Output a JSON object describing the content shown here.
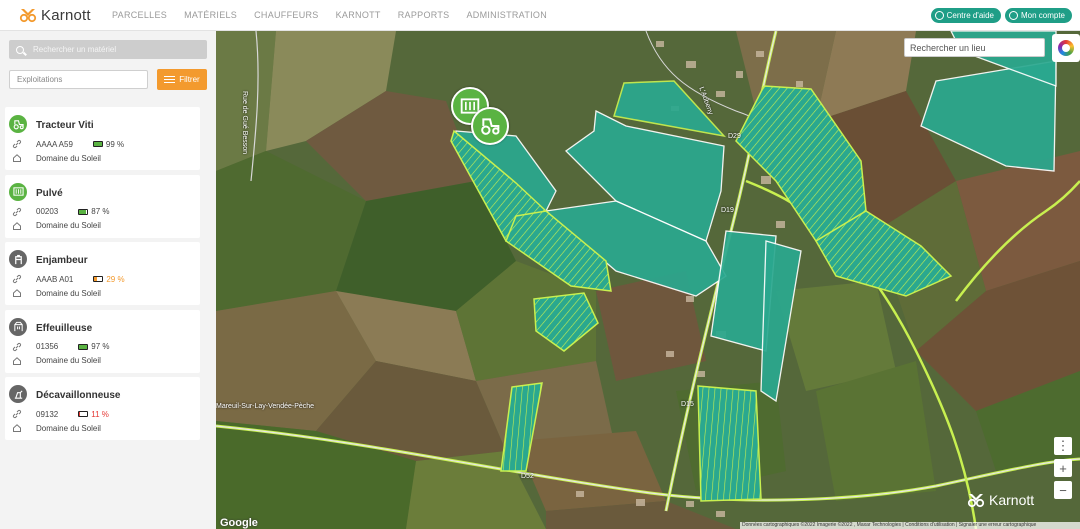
{
  "app": {
    "name": "Karnott"
  },
  "nav": [
    "PARCELLES",
    "MATÉRIELS",
    "CHAUFFEURS",
    "KARNOTT",
    "RAPPORTS",
    "ADMINISTRATION"
  ],
  "header_buttons": {
    "help": "Centre d'aide",
    "account": "Mon compte"
  },
  "sidebar": {
    "search_placeholder": "Rechercher un matériel",
    "collapse_icon": "double-chevron-left",
    "exploitations_placeholder": "Exploitations",
    "filter_label": "Filtrer",
    "equipment": [
      {
        "name": "Tracteur Viti",
        "icon": "tractor-icon",
        "badge_color": "#5ab342",
        "id": "AAAA A59",
        "battery": "99 %",
        "battery_level": 0.99,
        "battery_color": "#5ab342",
        "location": "Domaine du Soleil"
      },
      {
        "name": "Pulvé",
        "icon": "sprayer-icon",
        "badge_color": "#5ab342",
        "id": "00203",
        "battery": "87 %",
        "battery_level": 0.87,
        "battery_color": "#5ab342",
        "location": "Domaine du Soleil"
      },
      {
        "name": "Enjambeur",
        "icon": "straddle-tractor-icon",
        "badge_color": "#666666",
        "id": "AAAB A01",
        "battery": "29 %",
        "battery_level": 0.29,
        "battery_color": "#f39a2e",
        "location": "Domaine du Soleil"
      },
      {
        "name": "Effeuilleuse",
        "icon": "leaf-stripper-icon",
        "badge_color": "#666666",
        "id": "01356",
        "battery": "97 %",
        "battery_level": 0.97,
        "battery_color": "#5ab342",
        "location": "Domaine du Soleil"
      },
      {
        "name": "Décavaillonneuse",
        "icon": "plough-icon",
        "badge_color": "#666666",
        "id": "09132",
        "battery": "11 %",
        "battery_level": 0.11,
        "battery_color": "#e53935",
        "location": "Domaine du Soleil"
      }
    ]
  },
  "map": {
    "search_placeholder": "Rechercher un lieu",
    "roads": [
      "Rue de Gué Besson",
      "L'Aubeny",
      "D29",
      "D19",
      "D15",
      "D52"
    ],
    "place": "Mareuil-Sur-Lay-Vendée-Pèche",
    "attribution": "Données cartographiques ©2022 Imagerie ©2022 , Maxar Technologies | Conditions d'utilisation | Signaler une erreur cartographique",
    "google": "Google",
    "watermark": "Karnott",
    "zoom_in": "+",
    "zoom_out": "−",
    "more": "⋮",
    "colors": {
      "field_fill": "#2aa88f",
      "field_outline": "#c8f050",
      "marker": "#5ab342"
    }
  }
}
